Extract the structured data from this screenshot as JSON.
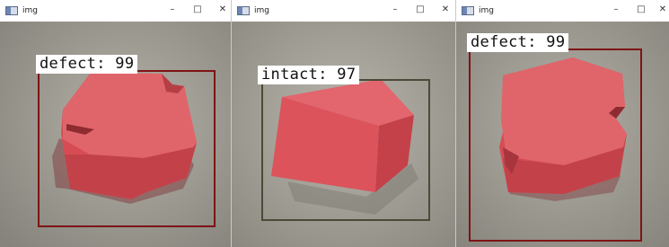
{
  "windows": [
    {
      "title": "img",
      "detection": {
        "class": "defect",
        "score": "99",
        "label_text": "defect: 99",
        "box_color": "#7e1414"
      }
    },
    {
      "title": "img",
      "detection": {
        "class": "intact",
        "score": "97",
        "label_text": "intact: 97",
        "box_color": "#4a4a38"
      }
    },
    {
      "title": "img",
      "detection": {
        "class": "defect",
        "score": "99",
        "label_text": "defect: 99",
        "box_color": "#7e1414"
      }
    }
  ],
  "controls": {
    "minimize": "–",
    "maximize": "□",
    "close": "✕"
  },
  "icons": {
    "app": "image-window-icon"
  },
  "colors": {
    "cube": "#d9565a",
    "background": "#9c9a92"
  }
}
